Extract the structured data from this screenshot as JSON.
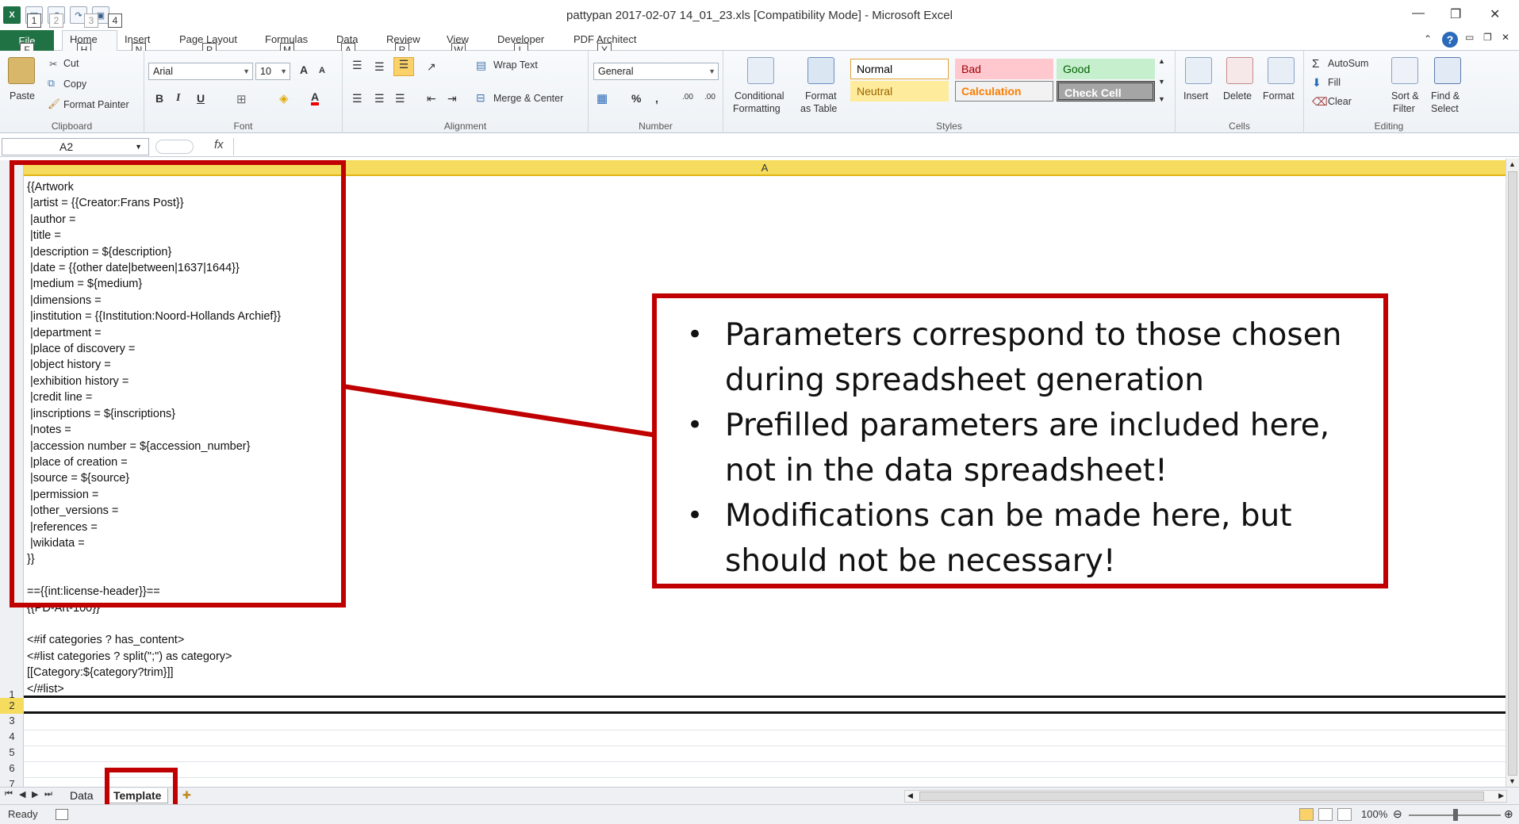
{
  "window": {
    "title": "pattypan 2017-02-07 14_01_23.xls  [Compatibility Mode]  -  Microsoft Excel",
    "app_icon": "X",
    "quick_access": [
      "1",
      "2",
      "3",
      "4"
    ]
  },
  "ribbon_tabs": {
    "file": "File",
    "items": [
      "Home",
      "Insert",
      "Page Layout",
      "Formulas",
      "Data",
      "Review",
      "View",
      "Developer",
      "PDF Architect"
    ],
    "keytips": [
      "F",
      "H",
      "N",
      "P",
      "M",
      "A",
      "R",
      "W",
      "L",
      "Y"
    ]
  },
  "ribbon": {
    "clipboard": {
      "label": "Clipboard",
      "paste": "Paste",
      "cut": "Cut",
      "copy": "Copy",
      "format_painter": "Format Painter"
    },
    "font": {
      "label": "Font",
      "font_name": "Arial",
      "font_size": "10",
      "bold": "B",
      "italic": "I",
      "underline": "U",
      "grow": "A",
      "shrink": "A"
    },
    "alignment": {
      "label": "Alignment",
      "wrap_text": "Wrap Text",
      "merge_center": "Merge & Center"
    },
    "number": {
      "label": "Number",
      "format": "General",
      "percent": "%",
      "comma": ",",
      "inc_dec": ".00",
      "dec_dec": ".00"
    },
    "styles": {
      "label": "Styles",
      "conditional": "Conditional",
      "formatting": "Formatting",
      "format_as": "Format",
      "as_table": "as Table",
      "cells": [
        {
          "name": "Normal",
          "bg": "#ffffff",
          "color": "#000000",
          "border": "#e2a33a"
        },
        {
          "name": "Bad",
          "bg": "#ffc7ce",
          "color": "#9c0006",
          "border": "#ffc7ce"
        },
        {
          "name": "Good",
          "bg": "#c6efce",
          "color": "#006100",
          "border": "#c6efce"
        },
        {
          "name": "Neutral",
          "bg": "#ffeb9c",
          "color": "#9c6500",
          "border": "#ffeb9c"
        },
        {
          "name": "Calculation",
          "bg": "#f2f2f2",
          "color": "#fa7d00",
          "border": "#7f7f7f"
        },
        {
          "name": "Check Cell",
          "bg": "#a5a5a5",
          "color": "#ffffff",
          "border": "#3f3f3f"
        }
      ]
    },
    "cells": {
      "label": "Cells",
      "insert": "Insert",
      "delete": "Delete",
      "format": "Format"
    },
    "editing": {
      "label": "Editing",
      "autosum": "AutoSum",
      "fill": "Fill",
      "clear": "Clear",
      "sort_filter": "Sort &",
      "filter": "Filter",
      "find_select": "Find &",
      "select": "Select"
    }
  },
  "formula_bar": {
    "name_box": "A2",
    "fx": "fx",
    "content": ""
  },
  "grid": {
    "column_header": "A",
    "cell_lines": [
      "{{Artwork",
      " |artist = {{Creator:Frans Post}}",
      " |author =",
      " |title =",
      " |description = ${description}",
      " |date = {{other date|between|1637|1644}}",
      " |medium = ${medium}",
      " |dimensions =",
      " |institution = {{Institution:Noord-Hollands Archief}}",
      " |department =",
      " |place of discovery =",
      " |object history =",
      " |exhibition history =",
      " |credit line =",
      " |inscriptions = ${inscriptions}",
      " |notes =",
      " |accession number = ${accession_number}",
      " |place of creation =",
      " |source = ${source}",
      " |permission =",
      " |other_versions =",
      " |references =",
      " |wikidata =",
      "}}",
      "",
      "=={{int:license-header}}==",
      "{{PD-Art-100}}",
      "",
      "<#if categories ? has_content>",
      "<#list categories ? split(\";\") as category>",
      "[[Category:${category?trim}]]",
      "</#list>"
    ],
    "rows": [
      "1",
      "2",
      "3",
      "4",
      "5",
      "6",
      "7"
    ]
  },
  "callout": {
    "bullets": [
      "Parameters correspond to those chosen during spreadsheet generation",
      "Prefilled parameters are included here, not in the data spreadsheet!",
      "Modifications can be made here, but should not be necessary!"
    ],
    "accent": "#c00000"
  },
  "sheets": {
    "tabs": [
      "Data",
      "Template"
    ],
    "active": "Template"
  },
  "status": {
    "state": "Ready",
    "zoom": "100%"
  }
}
